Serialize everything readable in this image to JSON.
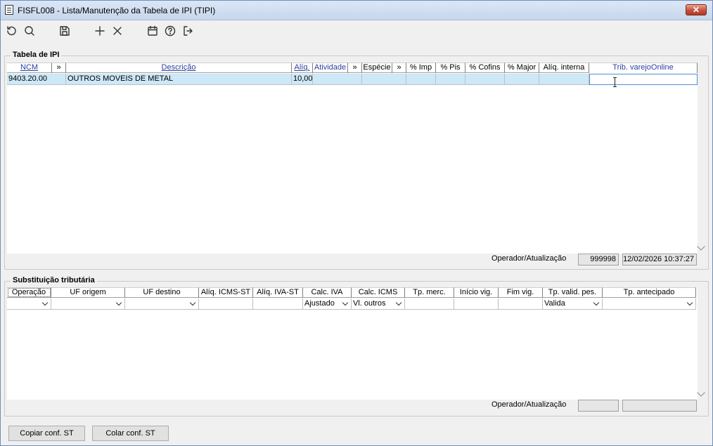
{
  "window": {
    "title": "FISFL008 - Lista/Manutenção da Tabela de IPI (TIPI)",
    "close_label": "✕"
  },
  "toolbar": {
    "icons": [
      "refresh-icon",
      "search-icon",
      "save-icon",
      "add-icon",
      "delete-icon",
      "calendar-icon",
      "help-icon",
      "exit-icon"
    ]
  },
  "ipi": {
    "legend": "Tabela de IPI",
    "columns": [
      "NCM",
      "»",
      "Descrição",
      "Alíq.",
      "Atividade",
      "»",
      "Espécie",
      "»",
      "% Imp",
      "% Pis",
      "% Cofins",
      "% Major",
      "Alíq. interna",
      "Trib. varejoOnline"
    ],
    "rows": [
      {
        "ncm": "9403.20.00",
        "descricao": "OUTROS MOVEIS DE METAL",
        "aliq": "10,00"
      }
    ],
    "status_label": "Operador/Atualização",
    "operator": "999998",
    "updated": "12/02/2026 10:37:27"
  },
  "st": {
    "legend": "Substituição tributária",
    "columns": [
      "Operação",
      "UF origem",
      "UF destino",
      "Alíq. ICMS-ST",
      "Alíq. IVA-ST",
      "Calc. IVA",
      "Calc. ICMS",
      "Tp. merc.",
      "Início vig.",
      "Fim vig.",
      "Tp. valid. pes.",
      "Tp. antecipado"
    ],
    "row": {
      "calc_iva": "Ajustado",
      "calc_icms": "Vl. outros",
      "tp_valid": "Valida"
    },
    "status_label": "Operador/Atualização",
    "operator": "",
    "updated": ""
  },
  "buttons": {
    "copy": "Copiar conf. ST",
    "paste": "Colar conf. ST"
  }
}
